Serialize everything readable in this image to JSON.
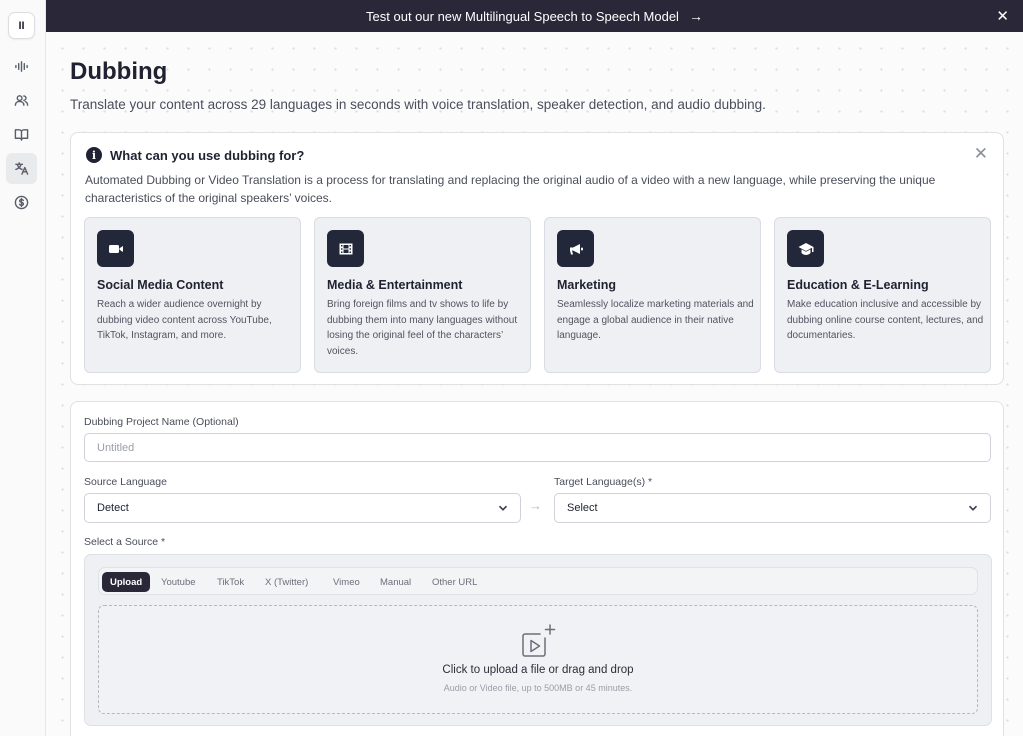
{
  "sidebar": {
    "logo": "II",
    "items": [
      {
        "icon": "waveform-icon"
      },
      {
        "icon": "users-icon"
      },
      {
        "icon": "book-icon"
      },
      {
        "icon": "translate-icon",
        "active": true
      },
      {
        "icon": "dollar-icon"
      }
    ]
  },
  "banner": {
    "text": "Test out our new Multilingual Speech to Speech Model",
    "arrow": "→",
    "close": "✕"
  },
  "page": {
    "title": "Dubbing",
    "subtitle": "Translate your content across 29 languages in seconds with voice translation, speaker detection, and audio dubbing."
  },
  "info": {
    "icon": "i",
    "title": "What can you use dubbing for?",
    "close": "✕",
    "description": "Automated Dubbing or Video Translation is a process for translating and replacing the original audio of a video with a new language, while preserving the unique characteristics of the original speakers’ voices.",
    "cards": [
      {
        "icon": "video-icon",
        "title": "Social Media Content",
        "desc": "Reach a wider audience overnight by dubbing video content across YouTube, TikTok, Instagram, and more."
      },
      {
        "icon": "film-icon",
        "title": "Media & Entertainment",
        "desc": "Bring foreign films and tv shows to life by dubbing them into many languages without losing the original feel of the characters’ voices."
      },
      {
        "icon": "megaphone-icon",
        "title": "Marketing",
        "desc": "Seamlessly localize marketing materials and engage a global audience in their native language."
      },
      {
        "icon": "graduation-cap-icon",
        "title": "Education & E-Learning",
        "desc": "Make education inclusive and accessible by dubbing online course content, lectures, and documentaries."
      }
    ]
  },
  "form": {
    "project_name_label": "Dubbing Project Name (Optional)",
    "project_name_placeholder": "Untitled",
    "source_language_label": "Source Language",
    "source_language_value": "Detect",
    "arrow": "→",
    "target_language_label": "Target Language(s) *",
    "target_language_value": "Select",
    "source_label": "Select a Source *",
    "tabs": [
      "Upload",
      "Youtube",
      "TikTok",
      "X (Twitter)",
      "Vimeo",
      "Manual",
      "Other URL"
    ],
    "active_tab": "Upload",
    "dropzone_title": "Click to upload a file or drag and drop",
    "dropzone_sub": "Audio or Video file, up to 500MB or 45 minutes."
  }
}
